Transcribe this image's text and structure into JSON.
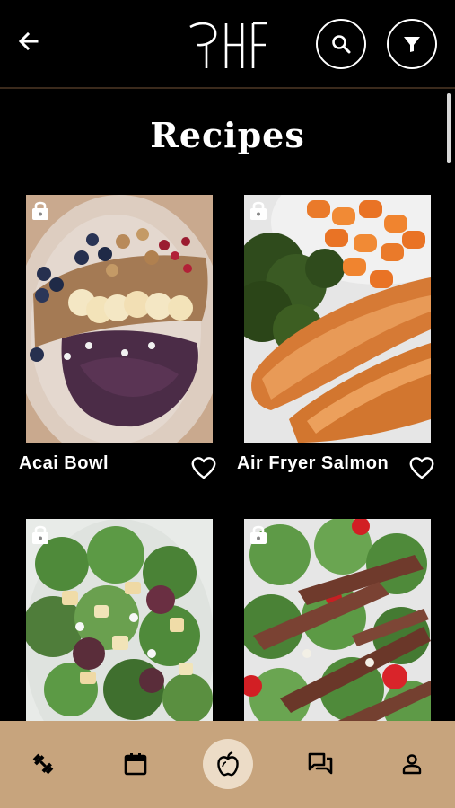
{
  "header": {
    "back_icon": "arrow-left-icon",
    "logo_text": "RHF",
    "search_icon": "search-icon",
    "filter_icon": "filter-icon"
  },
  "page": {
    "title": "Recipes"
  },
  "recipes": [
    {
      "name": "Acai Bowl",
      "locked": true,
      "favorite": false
    },
    {
      "name": "Air Fryer Salmon",
      "locked": true,
      "favorite": false
    },
    {
      "name": "",
      "locked": true,
      "favorite": false
    },
    {
      "name": "",
      "locked": true,
      "favorite": false
    }
  ],
  "bottom_nav": {
    "items": [
      {
        "icon": "dumbbell-icon",
        "active": false
      },
      {
        "icon": "calendar-icon",
        "active": false
      },
      {
        "icon": "apple-icon",
        "active": true
      },
      {
        "icon": "chat-icon",
        "active": false
      },
      {
        "icon": "person-icon",
        "active": false
      }
    ]
  },
  "colors": {
    "background": "#000000",
    "nav_background": "#c7a47d",
    "nav_active": "#ecdcc7",
    "text": "#ffffff"
  }
}
